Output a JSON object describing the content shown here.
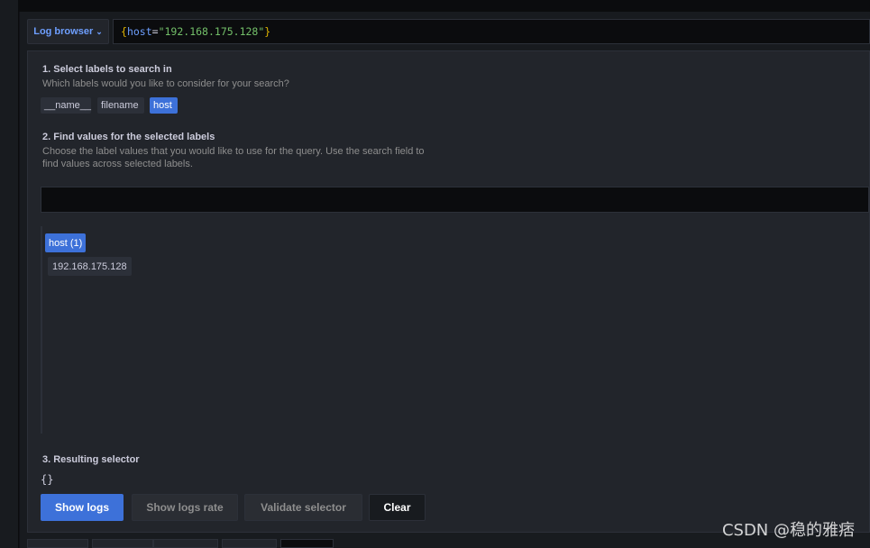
{
  "query_editor": {
    "log_browser_label": "Log browser",
    "query": {
      "open_brace": "{",
      "key": "host",
      "equals": "=",
      "value": "\"192.168.175.128\"",
      "close_brace": "}"
    }
  },
  "label_browser": {
    "step1": {
      "title": "1. Select labels to search in",
      "description": "Which labels would you like to consider for your search?",
      "labels": [
        {
          "name": "__name__",
          "selected": false
        },
        {
          "name": "filename",
          "selected": false
        },
        {
          "name": "host",
          "selected": true
        }
      ]
    },
    "step2": {
      "title": "2. Find values for the selected labels",
      "description_line1": "Choose the label values that you would like to use for the query. Use the search field to",
      "description_line2": "find values across selected labels.",
      "search_value": "",
      "label_group": "host (1)",
      "values": [
        "192.168.175.128"
      ]
    },
    "step3": {
      "title": "3. Resulting selector",
      "selector": "{}"
    },
    "buttons": {
      "show_logs": "Show logs",
      "show_logs_rate": "Show logs rate",
      "validate_selector": "Validate selector",
      "clear": "Clear"
    }
  },
  "watermark": "CSDN @稳的雅痞",
  "colors": {
    "accent": "#3d71d9",
    "link": "#6e9fff",
    "brace": "#e0b400",
    "string": "#73bf69",
    "panel_bg": "#181b1f"
  }
}
